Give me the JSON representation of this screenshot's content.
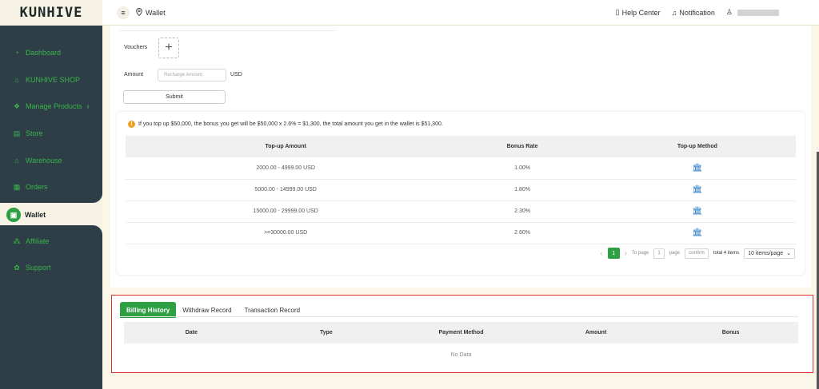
{
  "brand": {
    "logo_text": "KUNHIVE",
    "logo_sub": "KUNHIVE"
  },
  "sidebar": {
    "items": [
      {
        "label": "Dashboard",
        "icon": "dashboard-icon"
      },
      {
        "label": "KUNHIVE SHOP",
        "icon": "shop-bag-icon"
      },
      {
        "label": "Manage Products",
        "icon": "products-icon",
        "chevron": "›"
      },
      {
        "label": "Store",
        "icon": "store-icon"
      },
      {
        "label": "Warehouse",
        "icon": "warehouse-icon"
      },
      {
        "label": "Orders",
        "icon": "orders-icon"
      },
      {
        "label": "Wallet",
        "icon": "wallet-icon",
        "active": true
      },
      {
        "label": "Affiliate",
        "icon": "affiliate-icon"
      },
      {
        "label": "Support",
        "icon": "support-icon"
      }
    ]
  },
  "header": {
    "menu_icon": "≡",
    "breadcrumb": "Wallet",
    "help_center": "Help Center",
    "notification": "Notification"
  },
  "recharge": {
    "vouchers_label": "Vouchers",
    "add_symbol": "+",
    "amount_label": "Amount",
    "amount_placeholder": "Recharge Amount",
    "currency": "USD",
    "submit_label": "Submit"
  },
  "info": {
    "warn_symbol": "!",
    "text": "If you top up $50,000, the bonus you get will be $50,000 x 2.6% = $1,300, the total amount you get in the wallet is $51,300."
  },
  "rate_table": {
    "headers": [
      "Top-up Amount",
      "Bonus Rate",
      "Top-up Method"
    ],
    "rows": [
      {
        "amount": "2000.00 - 4999.00 USD",
        "rate": "1.00%"
      },
      {
        "amount": "5000.00 - 14999.00 USD",
        "rate": "1.80%"
      },
      {
        "amount": "15000.00 - 29999.00 USD",
        "rate": "2.30%"
      },
      {
        "amount": ">=30000.00 USD",
        "rate": "2.60%"
      }
    ]
  },
  "pager": {
    "prev": "‹",
    "current": "1",
    "next": "›",
    "to_page": "To page",
    "page_input": "1",
    "page": "page",
    "confirm": "confirm",
    "total": "total 4 items",
    "page_size": "10 items/page"
  },
  "billing": {
    "tabs": [
      "Billing History",
      "Withdraw Record",
      "Transaction Record"
    ],
    "columns": [
      "Date",
      "Type",
      "Payment Method",
      "Amount",
      "Bonus"
    ],
    "empty": "No Data"
  },
  "colors": {
    "accent": "#2ea043",
    "sidebar_bg": "#2d3e46",
    "highlight_border": "#e03030"
  }
}
